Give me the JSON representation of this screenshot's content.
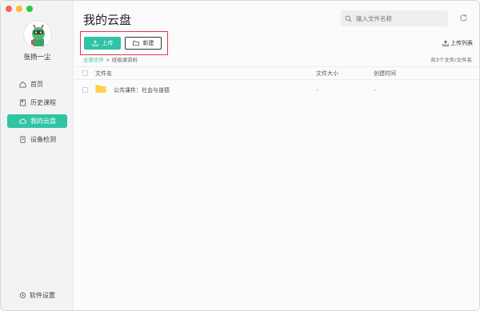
{
  "window": {
    "traffic_lights": [
      "close",
      "minimize",
      "zoom"
    ],
    "colors": {
      "close": "#fe5f57",
      "minimize": "#febc2e",
      "zoom": "#28c840"
    }
  },
  "sidebar": {
    "username": "张扬一尘",
    "items": [
      {
        "icon": "home-icon",
        "label": "首页",
        "active": false
      },
      {
        "icon": "book-icon",
        "label": "历史课程",
        "active": false
      },
      {
        "icon": "cloud-icon",
        "label": "我的云盘",
        "active": true
      },
      {
        "icon": "device-icon",
        "label": "设备检测",
        "active": false
      }
    ],
    "settings_label": "软件设置",
    "accent": "#2fc4a4"
  },
  "main": {
    "title": "我的云盘",
    "search": {
      "placeholder": "输入文件名称",
      "value": ""
    },
    "toolbar": {
      "upload_label": "上传",
      "new_label": "新建",
      "upload_list_label": "上传列表"
    },
    "breadcrumb": {
      "root": "全部文件",
      "separator": ">",
      "current": "班级课资料"
    },
    "file_count": "共3个文件/文件夹",
    "table": {
      "headers": {
        "name": "文件名",
        "size": "文件大小",
        "created": "创建时间"
      },
      "rows": [
        {
          "icon": "folder-icon",
          "name": "公共课件：社会与道德",
          "size": "–",
          "created": "–"
        }
      ]
    }
  }
}
